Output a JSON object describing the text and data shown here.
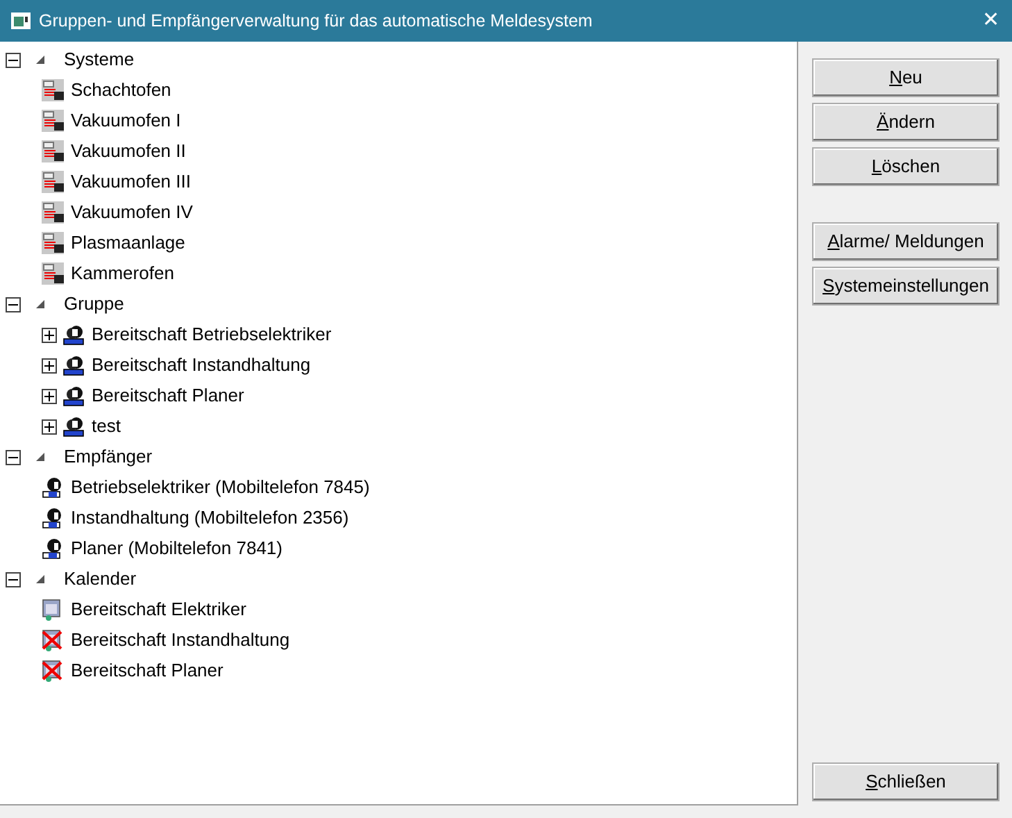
{
  "window": {
    "title": "Gruppen- und Empfängerverwaltung für das automatische Meldesystem",
    "close": "✕"
  },
  "tree": [
    {
      "label": "Systeme",
      "expanded": true,
      "children": [
        {
          "label": "Schachtofen",
          "kind": "system"
        },
        {
          "label": "Vakuumofen I",
          "kind": "system"
        },
        {
          "label": "Vakuumofen II",
          "kind": "system"
        },
        {
          "label": "Vakuumofen III",
          "kind": "system"
        },
        {
          "label": "Vakuumofen IV",
          "kind": "system"
        },
        {
          "label": "Plasmaanlage",
          "kind": "system"
        },
        {
          "label": "Kammerofen",
          "kind": "system"
        }
      ]
    },
    {
      "label": "Gruppe",
      "expanded": true,
      "children": [
        {
          "label": "Bereitschaft Betriebselektriker",
          "kind": "group",
          "expanded": false
        },
        {
          "label": "Bereitschaft Instandhaltung",
          "kind": "group",
          "expanded": false
        },
        {
          "label": "Bereitschaft Planer",
          "kind": "group",
          "expanded": false
        },
        {
          "label": "test",
          "kind": "group",
          "expanded": false
        }
      ]
    },
    {
      "label": "Empfänger",
      "expanded": true,
      "children": [
        {
          "label": "Betriebselektriker (Mobiltelefon 7845)",
          "kind": "recipient"
        },
        {
          "label": "Instandhaltung (Mobiltelefon 2356)",
          "kind": "recipient"
        },
        {
          "label": "Planer (Mobiltelefon 7841)",
          "kind": "recipient"
        }
      ]
    },
    {
      "label": "Kalender",
      "expanded": true,
      "children": [
        {
          "label": "Bereitschaft Elektriker",
          "kind": "calendar",
          "disabled": false
        },
        {
          "label": "Bereitschaft Instandhaltung",
          "kind": "calendar",
          "disabled": true
        },
        {
          "label": "Bereitschaft Planer",
          "kind": "calendar",
          "disabled": true
        }
      ]
    }
  ],
  "button_groups": [
    [
      "Neu",
      "Ändern",
      "Löschen"
    ],
    [
      "Alarme/ Meldungen",
      "Systemeinstellungen"
    ],
    [
      "Schließen"
    ]
  ]
}
